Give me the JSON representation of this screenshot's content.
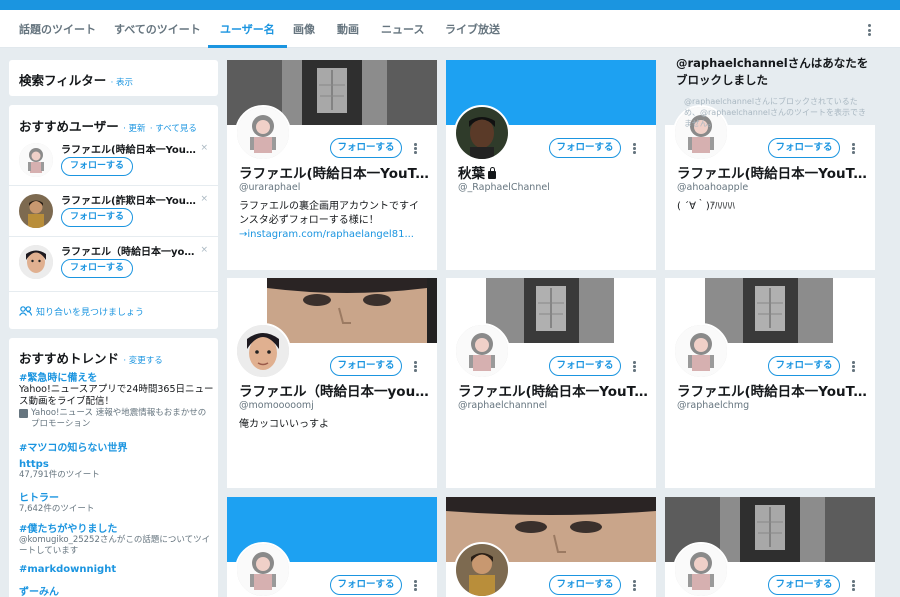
{
  "nav": {
    "tabs": [
      "話題のツイート",
      "すべてのツイート",
      "ユーザー名",
      "画像",
      "動画",
      "ニュース",
      "ライブ放送"
    ],
    "active_tab": "ユーザー名"
  },
  "search_filter": {
    "title": "検索フィルター",
    "show_link": "· 表示"
  },
  "who_to_follow": {
    "title": "おすすめユーザー",
    "refresh": "· 更新",
    "view_all": "· すべて見る",
    "users": [
      {
        "name": "ラファエル(時給日本一YouTuber)",
        "button": "フォローする",
        "close": "×"
      },
      {
        "name": "ラファエル(詐欺日本一YouTuber)",
        "button": "フォローする",
        "close": "×"
      },
      {
        "name": "ラファエル（時給日本一youtuber）",
        "button": "フォローする",
        "close": "×"
      }
    ],
    "find_friends": "知り合いを見つけましょう"
  },
  "trends": {
    "title": "おすすめトレンド",
    "change": "· 変更する",
    "items": [
      {
        "name": "#緊急時に備えを",
        "desc": "Yahoo!ニュースアプリで24時間365日ニュース動画をライブ配信！",
        "sub": "Yahoo!ニュース 速報や地震情報もおまかせのプロモーション"
      },
      {
        "name": "#マツコの知らない世界",
        "desc": "",
        "sub": ""
      },
      {
        "name": "https",
        "desc": "",
        "sub": "47,791件のツイート"
      },
      {
        "name": "ヒトラー",
        "desc": "",
        "sub": "7,642件のツイート"
      },
      {
        "name": "#僕たちがやりました",
        "desc": "",
        "sub": "@komugiko_25252さんがこの話題についてツイートしています"
      },
      {
        "name": "#markdownnight",
        "desc": "",
        "sub": ""
      },
      {
        "name": "ずーみん",
        "desc": "",
        "sub": ""
      }
    ]
  },
  "cards": [
    {
      "name": "ラファエル(時給日本一YouTuber)",
      "handle": "@uraraphael",
      "bio": "ラファエルの裏企画用アカウントですインスタ必ずフォローする様に！",
      "link": "→instagram.com/raphaelangel81...",
      "button": "フォローする",
      "banner": "photo"
    },
    {
      "name": "秋葉",
      "handle": "@_RaphaelChannel",
      "bio": "",
      "link": "",
      "button": "フォローする",
      "banner": "blue",
      "protected": true
    },
    {
      "name": "ラファエル(時給日本一YouTuber)",
      "handle": "@ahoahoapple",
      "bio": "( ´∀｀)ｱﾊﾊﾊﾊ",
      "link": "",
      "button": "フォローする",
      "banner": "blocked"
    },
    {
      "name": "ラファエル（時給日本一youtuber）",
      "handle": "@momooooomj",
      "bio": "俺カッコいいっすよ",
      "link": "",
      "button": "フォローする",
      "banner": "face"
    },
    {
      "name": "ラファエル(時給日本一YouTuber)",
      "handle": "@raphaelchannnel",
      "bio": "",
      "link": "",
      "button": "フォローする",
      "banner": "photo"
    },
    {
      "name": "ラファエル(時給日本一YouTuber)",
      "handle": "@raphaelchmg",
      "bio": "",
      "link": "",
      "button": "フォローする",
      "banner": "photo"
    },
    {
      "name": "",
      "handle": "",
      "bio": "",
      "link": "",
      "button": "フォローする",
      "banner": "blue"
    },
    {
      "name": "",
      "handle": "",
      "bio": "",
      "link": "",
      "button": "フォローする",
      "banner": "face"
    },
    {
      "name": "",
      "handle": "",
      "bio": "",
      "link": "",
      "button": "フォローする",
      "banner": "photo"
    }
  ],
  "blocked": {
    "title": "@raphaelchannelさんはあなたをブロックしました",
    "sub": "@raphaelchannelさんにブロックされているため、@raphaelchannelさんのツイートを表示できません。"
  },
  "colors": {
    "accent": "#1b95e0",
    "topbar": "#1b95e0",
    "background": "#e6ecf0",
    "banner_blue": "#1da1f2"
  }
}
